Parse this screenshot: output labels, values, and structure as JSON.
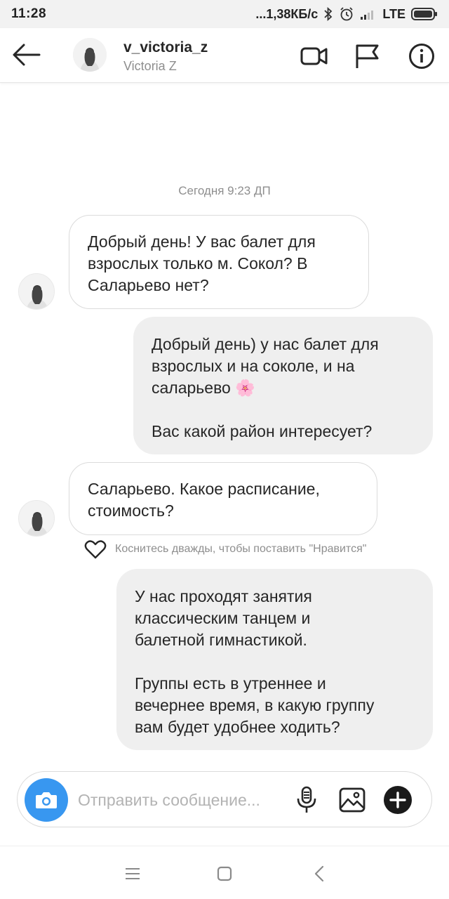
{
  "status_bar": {
    "time": "11:28",
    "speed": "...1,38КБ/с",
    "network": "LTE"
  },
  "header": {
    "username": "v_victoria_z",
    "full_name": "Victoria Z"
  },
  "thread": {
    "timestamp": "Сегодня 9:23 ДП",
    "messages": [
      {
        "side": "incoming",
        "text": "Добрый день! У вас балет для\nвзрослых только м. Сокол? В\nСаларьево нет?"
      },
      {
        "side": "outgoing",
        "text": "Добрый день) у нас балет для\nвзрослых и на соколе, и на\nсаларьево 🌸\n\nВас какой район интересует?"
      },
      {
        "side": "incoming",
        "text": "Саларьево.  Какое расписание,\nстоимость?"
      },
      {
        "side": "outgoing",
        "text": "У нас проходят занятия\nклассическим танцем и\nбалетной гимнастикой.\n\nГруппы есть в утреннее и\nвечернее время, в какую группу\nвам будет удобнее ходить?"
      }
    ],
    "like_hint": "Коснитесь дважды, чтобы поставить \"Нравится\""
  },
  "composer": {
    "placeholder": "Отправить сообщение..."
  },
  "colors": {
    "accent": "#3897f0",
    "outgoing_bubble": "#efefef",
    "incoming_border": "#dbdbdb",
    "secondary_text": "#8e8e8e",
    "flower": "#f4a7c0"
  },
  "icons": [
    "back-arrow-icon",
    "video-call-icon",
    "flag-icon",
    "info-icon",
    "heart-icon",
    "camera-icon",
    "microphone-icon",
    "gallery-icon",
    "plus-icon",
    "menu-icon",
    "home-square-icon",
    "back-chevron-icon"
  ]
}
